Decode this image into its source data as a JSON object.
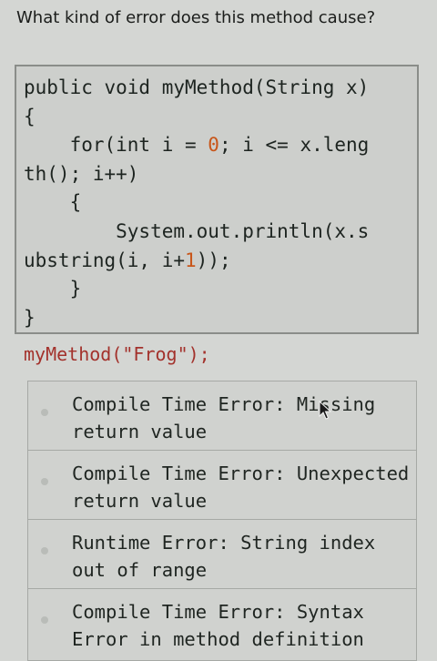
{
  "question": {
    "text": "What kind of error does this method cause?"
  },
  "code": {
    "lines": [
      "public void myMethod(String x)",
      "{",
      "    for(int i = ",
      "th(); i++)",
      "    {",
      "        System.out.println(x.s",
      "ubstring(i, i+",
      "    }",
      "}"
    ],
    "line3_zero": "0",
    "line3_rest": "; i <= x.leng",
    "line7_one": "1",
    "line7_rest": "));"
  },
  "call": {
    "text": "myMethod(\"Frog\");"
  },
  "options": [
    {
      "label": "Compile Time Error: Missing return value"
    },
    {
      "label": "Compile Time Error: Unexpected return value"
    },
    {
      "label": "Runtime Error: String index out of range"
    },
    {
      "label": "Compile Time Error: Syntax Error in method definition"
    }
  ],
  "colors": {
    "background": "#d4d6d3",
    "code_text": "#1d2420",
    "number_literal": "#c8561a",
    "call_text": "#a3322c"
  },
  "icons": {
    "cursor": "mouse-pointer-icon"
  }
}
